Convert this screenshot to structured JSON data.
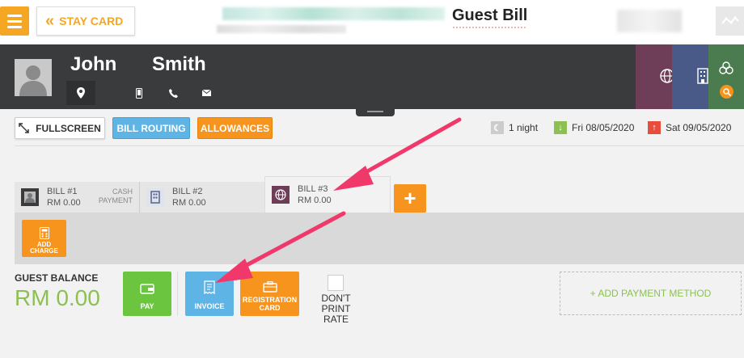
{
  "topbar": {
    "stay_card_label": "STAY CARD",
    "title": "Guest Bill"
  },
  "guest": {
    "first_name": "John",
    "last_name": "Smith"
  },
  "actions": {
    "fullscreen_label": "FULLSCREEN",
    "bill_routing_label": "BILL ROUTING",
    "allowances_label": "ALLOWANCES"
  },
  "stay": {
    "nights": "1 night",
    "arrival": "Fri 08/05/2020",
    "departure": "Sat 09/05/2020"
  },
  "bills": [
    {
      "name": "BILL #1",
      "amount": "RM 0.00",
      "payment_line1": "CASH",
      "payment_line2": "PAYMENT"
    },
    {
      "name": "BILL #2",
      "amount": "RM 0.00"
    },
    {
      "name": "BILL #3",
      "amount": "RM 0.00"
    }
  ],
  "add_bill_symbol": "+",
  "add_charge": {
    "line1": "ADD",
    "line2": "CHARGE"
  },
  "balance": {
    "label": "GUEST BALANCE",
    "value": "RM 0.00"
  },
  "bottom_actions": {
    "pay_label": "PAY",
    "invoice_label": "INVOICE",
    "registration_line1": "REGISTRATION",
    "registration_line2": "CARD",
    "dont_print_line1": "DON'T PRINT",
    "dont_print_line2": "RATE",
    "add_payment_label": "+ ADD PAYMENT METHOD"
  },
  "colors": {
    "orange": "#f7941d",
    "blue": "#5fb4e6",
    "green": "#8cc152",
    "dark_header": "#3a3b3d",
    "arrow": "#f0386b"
  }
}
